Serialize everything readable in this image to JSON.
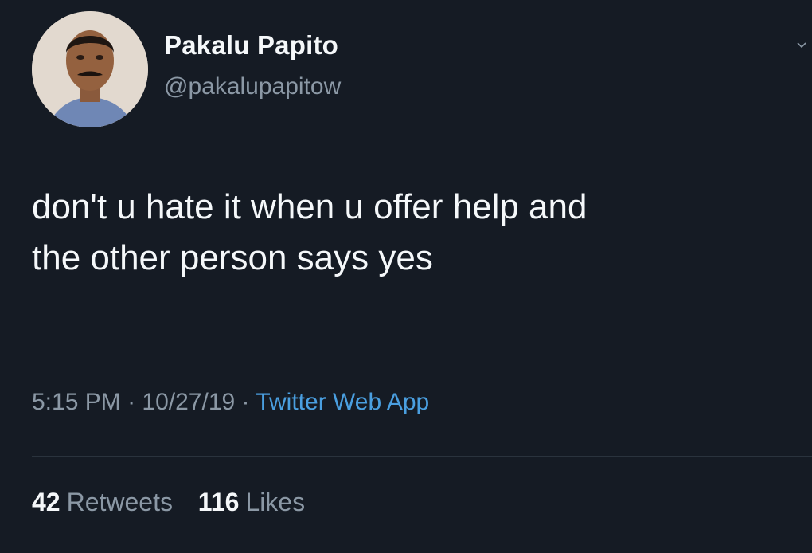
{
  "tweet": {
    "author": {
      "name": "Pakalu Papito",
      "handle": "@pakalupapitow"
    },
    "text_line1": "don't u hate it when u offer help and",
    "text_line2": "the other person says yes",
    "time": "5:15 PM",
    "date": "10/27/19",
    "separator": "·",
    "source": "Twitter Web App",
    "retweets_count": "42",
    "retweets_label": "Retweets",
    "likes_count": "116",
    "likes_label": "Likes"
  },
  "icons": {
    "avatar": "user-avatar-photo",
    "caret": "chevron-down-icon"
  },
  "colors": {
    "background": "#151b24",
    "primary_text": "#f5f8fa",
    "secondary_text": "#8b98a5",
    "link": "#4a9fe0",
    "divider": "#2a333d"
  }
}
